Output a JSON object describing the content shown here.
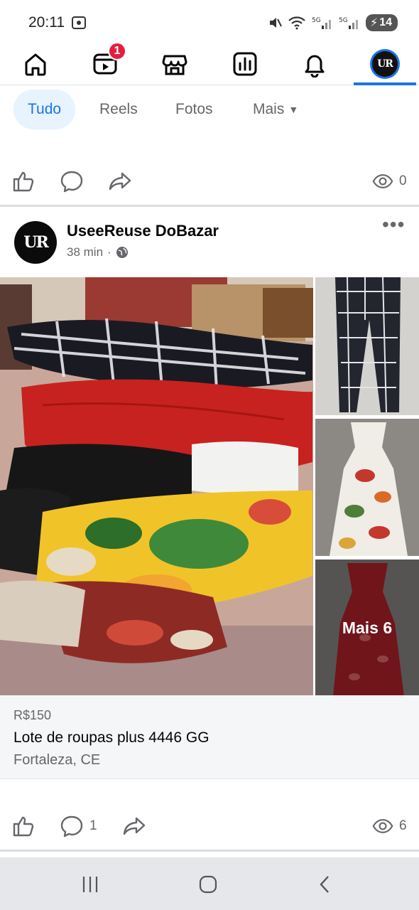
{
  "status_bar": {
    "time": "20:11",
    "battery": "14",
    "icons": [
      "mute-icon",
      "wifi-icon",
      "signal-5g-icon",
      "signal-5g-icon",
      "battery-icon"
    ]
  },
  "top_nav": {
    "items": [
      {
        "name": "home",
        "icon": "home-icon"
      },
      {
        "name": "video",
        "icon": "video-icon",
        "badge": "1"
      },
      {
        "name": "marketplace",
        "icon": "marketplace-icon"
      },
      {
        "name": "dashboard",
        "icon": "dashboard-icon"
      },
      {
        "name": "notifications",
        "icon": "bell-icon"
      },
      {
        "name": "profile",
        "icon": "avatar-icon",
        "active": true
      }
    ],
    "accent_color": "#1b74e4"
  },
  "filters": {
    "tabs": [
      {
        "label": "Tudo",
        "active": true
      },
      {
        "label": "Reels"
      },
      {
        "label": "Fotos"
      },
      {
        "label": "Mais"
      }
    ]
  },
  "previous_post": {
    "views": "0"
  },
  "post": {
    "author": "UseeReuse DoBazar",
    "avatar_text": "UR",
    "time": "38 min",
    "separator": "·",
    "more_photos": "Mais 6",
    "listing": {
      "price": "R$150",
      "title": "Lote de roupas plus 4446 GG",
      "location": "Fortaleza, CE"
    },
    "comments": "1",
    "views": "6"
  }
}
